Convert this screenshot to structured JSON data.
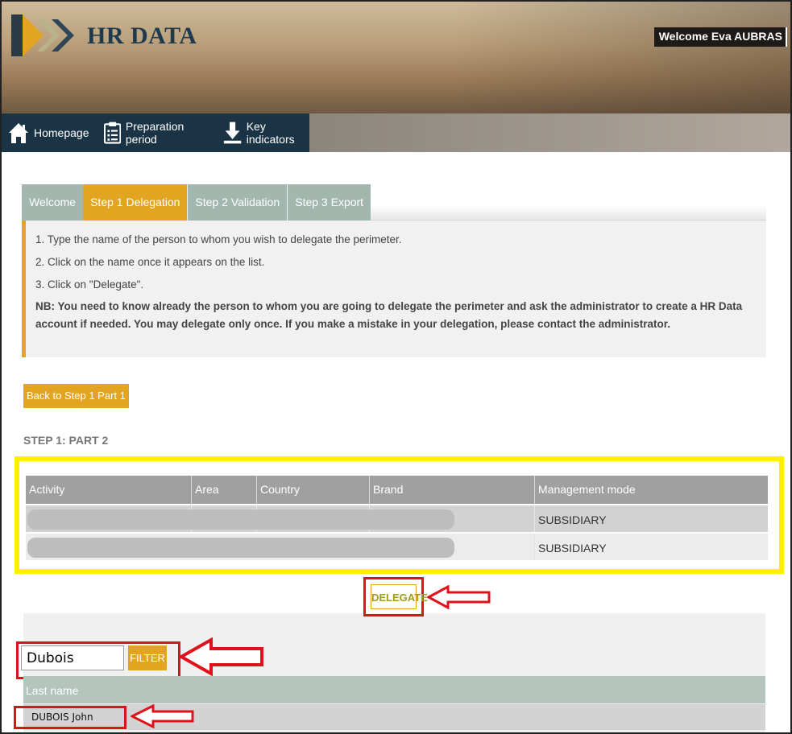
{
  "header": {
    "logo_text": "HR DATA",
    "welcome_text": "Welcome Eva AUBRAS"
  },
  "nav": {
    "items": [
      {
        "label": "Homepage",
        "icon": "home-icon"
      },
      {
        "label": "Preparation period",
        "icon": "checklist-icon"
      },
      {
        "label": "Key indicators",
        "icon": "download-icon"
      }
    ]
  },
  "tabs": [
    {
      "label": "Welcome",
      "active": false
    },
    {
      "label": "Step 1 Delegation",
      "active": true
    },
    {
      "label": "Step 2 Validation",
      "active": false
    },
    {
      "label": "Step 3 Export",
      "active": false
    }
  ],
  "instructions": {
    "line1": "1. Type the name of the person to whom you wish to delegate the perimeter.",
    "line2": "2. Click on the name once it appears on the list.",
    "line3": "3. Click on \"Delegate\".",
    "note": "NB: You need to know already the person to whom you are going to delegate the perimeter and ask the administrator to create a HR Data account if needed. You may delegate only once. If you make a mistake in your delegation, please contact the administrator."
  },
  "back_button": "Back to Step 1 Part 1",
  "step_title": "STEP 1: PART 2",
  "perimeter_table": {
    "columns": [
      "Activity",
      "Area",
      "Country",
      "Brand",
      "Management mode"
    ],
    "rows": [
      {
        "management_mode": "SUBSIDIARY"
      },
      {
        "management_mode": "SUBSIDIARY"
      }
    ]
  },
  "delegate_button": "DELEGATE",
  "filter": {
    "value": "Dubois",
    "button": "FILTER"
  },
  "results": {
    "column": "Last name",
    "rows": [
      "DUBOIS John"
    ]
  },
  "colors": {
    "accent": "#e2a421",
    "nav_bg": "#1a3446",
    "highlight_yellow": "#ffef00",
    "highlight_red": "#e0111b"
  }
}
